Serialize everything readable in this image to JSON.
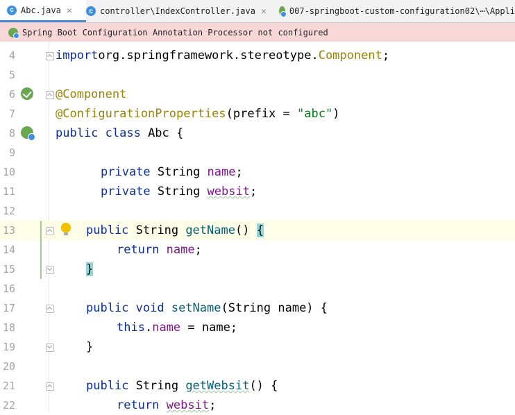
{
  "tabs": [
    {
      "label": "Abc.java",
      "icon": "class-icon",
      "close": "×"
    },
    {
      "label": "controller\\IndexController.java",
      "icon": "class-icon",
      "close": "×"
    },
    {
      "label": "007-springboot-custom-configuration02\\⋯\\Appli",
      "icon": "spring-boot-config-icon"
    }
  ],
  "banner": {
    "text": "Spring Boot Configuration Annotation Processor not configured"
  },
  "lines": [
    {
      "num": "4",
      "tokens": [
        [
          "kw",
          "import"
        ],
        [
          "",
          "org.springframework.stereotype."
        ],
        [
          "ann",
          "Component"
        ],
        [
          "",
          ";"
        ]
      ]
    },
    {
      "num": "5",
      "tokens": []
    },
    {
      "num": "6",
      "tokens": [
        [
          "ann",
          "@Component"
        ]
      ]
    },
    {
      "num": "7",
      "tokens": [
        [
          "ann",
          "@ConfigurationProperties"
        ],
        [
          "",
          "(prefix = "
        ],
        [
          "str",
          "\"abc\""
        ],
        [
          "",
          ")"
        ]
      ]
    },
    {
      "num": "8",
      "tokens": [
        [
          "kw",
          "public class "
        ],
        [
          "",
          "Abc {"
        ]
      ]
    },
    {
      "num": "9",
      "tokens": []
    },
    {
      "num": "10",
      "tokens": [
        [
          "kw",
          "private "
        ],
        [
          "",
          "String "
        ],
        [
          "fld",
          "name"
        ],
        [
          "",
          ";"
        ]
      ]
    },
    {
      "num": "11",
      "tokens": [
        [
          "kw",
          "private "
        ],
        [
          "",
          "String "
        ],
        [
          "fld typo",
          "websit"
        ],
        [
          "",
          ";"
        ]
      ]
    },
    {
      "num": "12",
      "tokens": []
    },
    {
      "num": "13",
      "tokens": [
        [
          "kw",
          "public "
        ],
        [
          "",
          "String "
        ],
        [
          "mth",
          "getName"
        ],
        [
          "",
          "() "
        ],
        [
          "brace-hl",
          "{"
        ]
      ]
    },
    {
      "num": "14",
      "tokens": [
        [
          "kw",
          "return "
        ],
        [
          "fld",
          "name"
        ],
        [
          "",
          ";"
        ]
      ]
    },
    {
      "num": "15",
      "tokens": [
        [
          "brace-hl",
          "}"
        ]
      ]
    },
    {
      "num": "16",
      "tokens": []
    },
    {
      "num": "17",
      "tokens": [
        [
          "kw",
          "public void "
        ],
        [
          "mth",
          "setName"
        ],
        [
          "",
          "(String name) {"
        ]
      ]
    },
    {
      "num": "18",
      "tokens": [
        [
          "kw",
          "this"
        ],
        [
          "",
          "."
        ],
        [
          "fld",
          "name"
        ],
        [
          "",
          " = name;"
        ]
      ]
    },
    {
      "num": "19",
      "tokens": [
        [
          "",
          "}"
        ]
      ]
    },
    {
      "num": "20",
      "tokens": []
    },
    {
      "num": "21",
      "tokens": [
        [
          "kw",
          "public "
        ],
        [
          "",
          "String "
        ],
        [
          "mth typo",
          "getWebsit"
        ],
        [
          "",
          "() {"
        ]
      ]
    },
    {
      "num": "22",
      "tokens": [
        [
          "kw",
          "return "
        ],
        [
          "fld typo",
          "websit"
        ],
        [
          "",
          ";"
        ]
      ]
    }
  ]
}
